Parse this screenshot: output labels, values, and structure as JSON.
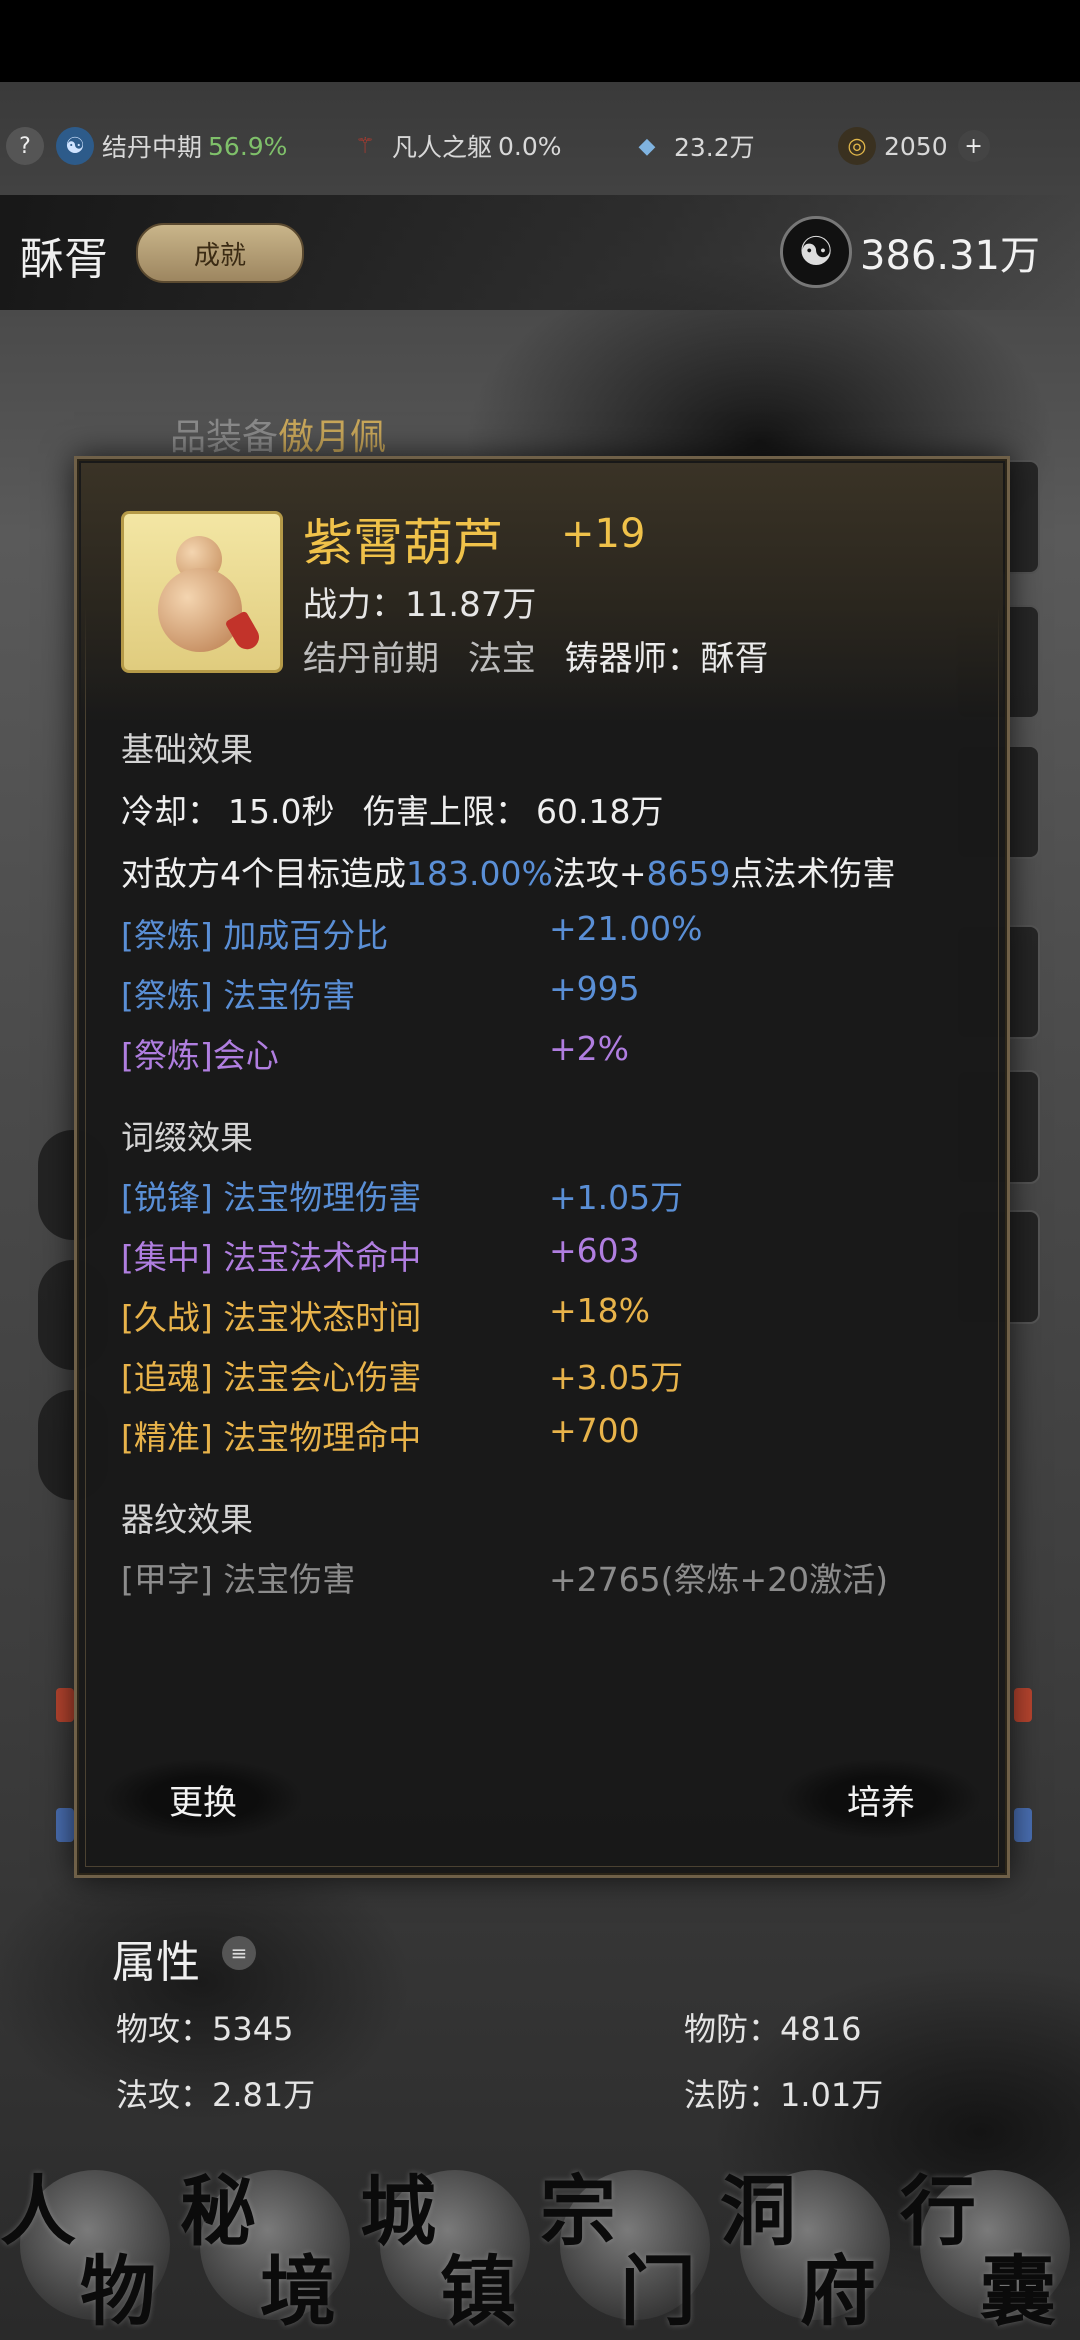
{
  "top_bar": {
    "help": "?",
    "realm": {
      "label": "结丹中期",
      "percent": "56.9%"
    },
    "body": {
      "label": "凡人之躯",
      "percent": "0.0%"
    },
    "stone": {
      "value": "23.2万"
    },
    "gold": {
      "value": "2050"
    },
    "add": "+"
  },
  "header": {
    "name": "酥胥",
    "badge": "成就",
    "currency": "386.31万"
  },
  "background": {
    "equip_line_prefix": "品装备",
    "equip_line_name": "傲月佩"
  },
  "popup": {
    "item_name": "紫霄葫芦",
    "item_level": "+19",
    "power_label": "战力：",
    "power_value": "11.87万",
    "realm": "结丹前期",
    "type": "法宝",
    "smith_label": "铸器师：",
    "smith_name": "酥胥",
    "base_title": "基础效果",
    "cooldown_label": "冷却：",
    "cooldown_value": "15.0秒",
    "dmg_cap_label": "伤害上限：",
    "dmg_cap_value": "60.18万",
    "desc_a": "对敌方4个目标造成",
    "desc_b": "183.00%",
    "desc_c": "法攻+",
    "desc_d": "8659",
    "desc_e": "点法术伤害",
    "base_rows": [
      {
        "label": "[祭炼] 加成百分比",
        "value": "+21.00%"
      },
      {
        "label": "[祭炼] 法宝伤害",
        "value": "+995"
      },
      {
        "label": "[祭炼]会心",
        "value": "+2%"
      }
    ],
    "affix_title": "词缀效果",
    "affix_rows": [
      {
        "label": "[锐锋] 法宝物理伤害",
        "value": "+1.05万"
      },
      {
        "label": "[集中] 法宝法术命中",
        "value": "+603"
      },
      {
        "label": "[久战] 法宝状态时间",
        "value": "+18%"
      },
      {
        "label": "[追魂] 法宝会心伤害",
        "value": "+3.05万"
      },
      {
        "label": "[精准] 法宝物理命中",
        "value": "+700"
      }
    ],
    "pattern_title": "器纹效果",
    "pattern_row": {
      "label": "[甲字] 法宝伤害",
      "value": "+2765(祭炼+20激活)"
    },
    "btn_replace": "更换",
    "btn_train": "培养"
  },
  "attributes": {
    "title": "属性",
    "phys_atk": "物攻：5345",
    "phys_def": "物防：4816",
    "mag_atk": "法攻：2.81万",
    "mag_def": "法防：1.01万"
  },
  "nav": [
    {
      "c1": "人",
      "c2": "物"
    },
    {
      "c1": "秘",
      "c2": "境"
    },
    {
      "c1": "城",
      "c2": "镇"
    },
    {
      "c1": "宗",
      "c2": "门"
    },
    {
      "c1": "洞",
      "c2": "府"
    },
    {
      "c1": "行",
      "c2": "囊"
    }
  ],
  "colors": {
    "gold": "#f0c24a",
    "blue": "#5a8fd6",
    "purple": "#b07ee0",
    "orange_gold": "#e8b34a"
  }
}
